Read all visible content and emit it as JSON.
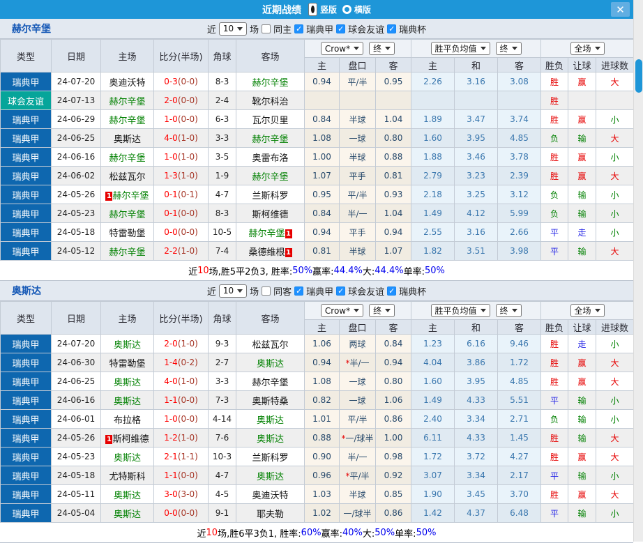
{
  "titlebar": {
    "title": "近期战绩",
    "view_vertical": "竖版",
    "view_horizontal": "横版",
    "close_label": "✕"
  },
  "table": {
    "columns": {
      "type": "类型",
      "date": "日期",
      "home": "主场",
      "score": "比分(半场)",
      "corner": "角球",
      "away": "客场",
      "odds_home": "主",
      "handicap": "盘口",
      "odds_away": "客",
      "mean_home": "主",
      "mean_draw": "和",
      "mean_away": "客",
      "result": "胜负",
      "handicap_result": "让球",
      "goals": "进球数"
    },
    "dropdowns": {
      "odds_source": "Crow*",
      "odds_stage": "终",
      "mean_source": "胜平负均值",
      "mean_stage": "终",
      "scope": "全场"
    }
  },
  "filter_labels": {
    "near": "近",
    "games": "场"
  },
  "sections": [
    {
      "team": "赫尔辛堡",
      "filter": {
        "count": "10",
        "same": "同主",
        "same_checked": false,
        "leagues": [
          "瑞典甲",
          "球会友谊",
          "瑞典杯"
        ]
      },
      "rows": [
        {
          "league": "瑞典甲",
          "league_type": "league",
          "date": "24-07-20",
          "home": {
            "name": "奥迪沃特",
            "green": false
          },
          "score": "0-3",
          "half": "(0-0)",
          "corners": "8-3",
          "away": {
            "name": "赫尔辛堡",
            "green": true
          },
          "odds": [
            "0.94",
            "平/半",
            "0.95"
          ],
          "means": [
            "2.26",
            "3.16",
            "3.08"
          ],
          "result": {
            "text": "胜",
            "color": "red"
          },
          "let_result": {
            "text": "赢",
            "color": "red"
          },
          "goals_result": {
            "text": "大",
            "color": "red"
          }
        },
        {
          "league": "球会友谊",
          "league_type": "friendly",
          "date": "24-07-13",
          "home": {
            "name": "赫尔辛堡",
            "green": true
          },
          "score": "2-0",
          "half": "(0-0)",
          "corners": "2-4",
          "away": {
            "name": "靴尔科治",
            "green": false
          },
          "odds": [
            "",
            "",
            ""
          ],
          "means": [
            "",
            "",
            ""
          ],
          "result": {
            "text": "胜",
            "color": "red"
          },
          "let_result": {
            "text": "",
            "color": "red"
          },
          "goals_result": {
            "text": "",
            "color": "red"
          }
        },
        {
          "league": "瑞典甲",
          "league_type": "league",
          "date": "24-06-29",
          "home": {
            "name": "赫尔辛堡",
            "green": true
          },
          "score": "1-0",
          "half": "(0-0)",
          "corners": "6-3",
          "away": {
            "name": "瓦尔贝里",
            "green": false
          },
          "odds": [
            "0.84",
            "半球",
            "1.04"
          ],
          "means": [
            "1.89",
            "3.47",
            "3.74"
          ],
          "result": {
            "text": "胜",
            "color": "red"
          },
          "let_result": {
            "text": "赢",
            "color": "red"
          },
          "goals_result": {
            "text": "小",
            "color": "green"
          }
        },
        {
          "league": "瑞典甲",
          "league_type": "league",
          "date": "24-06-25",
          "home": {
            "name": "奥斯达",
            "green": false
          },
          "score": "4-0",
          "half": "(1-0)",
          "corners": "3-3",
          "away": {
            "name": "赫尔辛堡",
            "green": true
          },
          "odds": [
            "1.08",
            "一球",
            "0.80"
          ],
          "means": [
            "1.60",
            "3.95",
            "4.85"
          ],
          "result": {
            "text": "负",
            "color": "green"
          },
          "let_result": {
            "text": "输",
            "color": "green"
          },
          "goals_result": {
            "text": "大",
            "color": "red"
          }
        },
        {
          "league": "瑞典甲",
          "league_type": "league",
          "date": "24-06-16",
          "home": {
            "name": "赫尔辛堡",
            "green": true
          },
          "score": "1-0",
          "half": "(1-0)",
          "corners": "3-5",
          "away": {
            "name": "奥雷布洛",
            "green": false
          },
          "odds": [
            "1.00",
            "半球",
            "0.88"
          ],
          "means": [
            "1.88",
            "3.46",
            "3.78"
          ],
          "result": {
            "text": "胜",
            "color": "red"
          },
          "let_result": {
            "text": "赢",
            "color": "red"
          },
          "goals_result": {
            "text": "小",
            "color": "green"
          }
        },
        {
          "league": "瑞典甲",
          "league_type": "league",
          "date": "24-06-02",
          "home": {
            "name": "松兹瓦尔",
            "green": false
          },
          "score": "1-3",
          "half": "(1-0)",
          "corners": "1-9",
          "away": {
            "name": "赫尔辛堡",
            "green": true
          },
          "odds": [
            "1.07",
            "平手",
            "0.81"
          ],
          "means": [
            "2.79",
            "3.23",
            "2.39"
          ],
          "result": {
            "text": "胜",
            "color": "red"
          },
          "let_result": {
            "text": "赢",
            "color": "red"
          },
          "goals_result": {
            "text": "大",
            "color": "red"
          }
        },
        {
          "league": "瑞典甲",
          "league_type": "league",
          "date": "24-05-26",
          "home": {
            "name": "赫尔辛堡",
            "green": true,
            "badge": "1",
            "badge_pos": "before"
          },
          "score": "0-1",
          "half": "(0-1)",
          "corners": "4-7",
          "away": {
            "name": "兰斯科罗",
            "green": false
          },
          "odds": [
            "0.95",
            "平/半",
            "0.93"
          ],
          "means": [
            "2.18",
            "3.25",
            "3.12"
          ],
          "result": {
            "text": "负",
            "color": "green"
          },
          "let_result": {
            "text": "输",
            "color": "green"
          },
          "goals_result": {
            "text": "小",
            "color": "green"
          }
        },
        {
          "league": "瑞典甲",
          "league_type": "league",
          "date": "24-05-23",
          "home": {
            "name": "赫尔辛堡",
            "green": true
          },
          "score": "0-1",
          "half": "(0-0)",
          "corners": "8-3",
          "away": {
            "name": "斯柯维德",
            "green": false
          },
          "odds": [
            "0.84",
            "半/一",
            "1.04"
          ],
          "means": [
            "1.49",
            "4.12",
            "5.99"
          ],
          "result": {
            "text": "负",
            "color": "green"
          },
          "let_result": {
            "text": "输",
            "color": "green"
          },
          "goals_result": {
            "text": "小",
            "color": "green"
          }
        },
        {
          "league": "瑞典甲",
          "league_type": "league",
          "date": "24-05-18",
          "home": {
            "name": "特雷勒堡",
            "green": false
          },
          "score": "0-0",
          "half": "(0-0)",
          "corners": "10-5",
          "away": {
            "name": "赫尔辛堡",
            "green": true,
            "badge": "1",
            "badge_pos": "after"
          },
          "odds": [
            "0.94",
            "平手",
            "0.94"
          ],
          "means": [
            "2.55",
            "3.16",
            "2.66"
          ],
          "result": {
            "text": "平",
            "color": "blue"
          },
          "let_result": {
            "text": "走",
            "color": "blue"
          },
          "goals_result": {
            "text": "小",
            "color": "green"
          }
        },
        {
          "league": "瑞典甲",
          "league_type": "league",
          "date": "24-05-12",
          "home": {
            "name": "赫尔辛堡",
            "green": true
          },
          "score": "2-2",
          "half": "(1-0)",
          "corners": "7-4",
          "away": {
            "name": "桑德维根",
            "green": false,
            "badge": "1",
            "badge_pos": "after"
          },
          "odds": [
            "0.81",
            "半球",
            "1.07"
          ],
          "means": [
            "1.82",
            "3.51",
            "3.98"
          ],
          "result": {
            "text": "平",
            "color": "blue"
          },
          "let_result": {
            "text": "输",
            "color": "green"
          },
          "goals_result": {
            "text": "大",
            "color": "red"
          }
        }
      ],
      "summary": [
        {
          "text": "近",
          "color": "black"
        },
        {
          "text": "10",
          "color": "red"
        },
        {
          "text": "场,胜5平2负3, 胜率:",
          "color": "black"
        },
        {
          "text": "50%",
          "color": "blue"
        },
        {
          "text": " 赢率:",
          "color": "black"
        },
        {
          "text": "44.4%",
          "color": "blue"
        },
        {
          "text": " 大:",
          "color": "black"
        },
        {
          "text": "44.4%",
          "color": "blue"
        },
        {
          "text": " 单率:",
          "color": "black"
        },
        {
          "text": "50%",
          "color": "blue"
        }
      ]
    },
    {
      "team": "奥斯达",
      "filter": {
        "count": "10",
        "same": "同客",
        "same_checked": false,
        "leagues": [
          "瑞典甲",
          "球会友谊",
          "瑞典杯"
        ]
      },
      "rows": [
        {
          "league": "瑞典甲",
          "league_type": "league",
          "date": "24-07-20",
          "home": {
            "name": "奥斯达",
            "green": true
          },
          "score": "2-0",
          "half": "(1-0)",
          "corners": "9-3",
          "away": {
            "name": "松兹瓦尔",
            "green": false
          },
          "odds": [
            "1.06",
            "两球",
            "0.84"
          ],
          "means": [
            "1.23",
            "6.16",
            "9.46"
          ],
          "result": {
            "text": "胜",
            "color": "red"
          },
          "let_result": {
            "text": "走",
            "color": "blue"
          },
          "goals_result": {
            "text": "小",
            "color": "green"
          }
        },
        {
          "league": "瑞典甲",
          "league_type": "league",
          "date": "24-06-30",
          "home": {
            "name": "特雷勒堡",
            "green": false
          },
          "score": "1-4",
          "half": "(0-2)",
          "corners": "2-7",
          "away": {
            "name": "奥斯达",
            "green": true
          },
          "odds": [
            "0.94",
            "*半/一",
            "0.94"
          ],
          "means": [
            "4.04",
            "3.86",
            "1.72"
          ],
          "result": {
            "text": "胜",
            "color": "red"
          },
          "let_result": {
            "text": "赢",
            "color": "red"
          },
          "goals_result": {
            "text": "大",
            "color": "red"
          }
        },
        {
          "league": "瑞典甲",
          "league_type": "league",
          "date": "24-06-25",
          "home": {
            "name": "奥斯达",
            "green": true
          },
          "score": "4-0",
          "half": "(1-0)",
          "corners": "3-3",
          "away": {
            "name": "赫尔辛堡",
            "green": false
          },
          "odds": [
            "1.08",
            "一球",
            "0.80"
          ],
          "means": [
            "1.60",
            "3.95",
            "4.85"
          ],
          "result": {
            "text": "胜",
            "color": "red"
          },
          "let_result": {
            "text": "赢",
            "color": "red"
          },
          "goals_result": {
            "text": "大",
            "color": "red"
          }
        },
        {
          "league": "瑞典甲",
          "league_type": "league",
          "date": "24-06-16",
          "home": {
            "name": "奥斯达",
            "green": true
          },
          "score": "1-1",
          "half": "(0-0)",
          "corners": "7-3",
          "away": {
            "name": "奥斯特桑",
            "green": false
          },
          "odds": [
            "0.82",
            "一球",
            "1.06"
          ],
          "means": [
            "1.49",
            "4.33",
            "5.51"
          ],
          "result": {
            "text": "平",
            "color": "blue"
          },
          "let_result": {
            "text": "输",
            "color": "green"
          },
          "goals_result": {
            "text": "小",
            "color": "green"
          }
        },
        {
          "league": "瑞典甲",
          "league_type": "league",
          "date": "24-06-01",
          "home": {
            "name": "布拉格",
            "green": false
          },
          "score": "1-0",
          "half": "(0-0)",
          "corners": "4-14",
          "away": {
            "name": "奥斯达",
            "green": true
          },
          "odds": [
            "1.01",
            "平/半",
            "0.86"
          ],
          "means": [
            "2.40",
            "3.34",
            "2.71"
          ],
          "result": {
            "text": "负",
            "color": "green"
          },
          "let_result": {
            "text": "输",
            "color": "green"
          },
          "goals_result": {
            "text": "小",
            "color": "green"
          }
        },
        {
          "league": "瑞典甲",
          "league_type": "league",
          "date": "24-05-26",
          "home": {
            "name": "斯柯维德",
            "green": false,
            "badge": "1",
            "badge_pos": "before"
          },
          "score": "1-2",
          "half": "(1-0)",
          "corners": "7-6",
          "away": {
            "name": "奥斯达",
            "green": true
          },
          "odds": [
            "0.88",
            "*一/球半",
            "1.00"
          ],
          "means": [
            "6.11",
            "4.33",
            "1.45"
          ],
          "result": {
            "text": "胜",
            "color": "red"
          },
          "let_result": {
            "text": "输",
            "color": "green"
          },
          "goals_result": {
            "text": "大",
            "color": "red"
          }
        },
        {
          "league": "瑞典甲",
          "league_type": "league",
          "date": "24-05-23",
          "home": {
            "name": "奥斯达",
            "green": true
          },
          "score": "2-1",
          "half": "(1-1)",
          "corners": "10-3",
          "away": {
            "name": "兰斯科罗",
            "green": false
          },
          "odds": [
            "0.90",
            "半/一",
            "0.98"
          ],
          "means": [
            "1.72",
            "3.72",
            "4.27"
          ],
          "result": {
            "text": "胜",
            "color": "red"
          },
          "let_result": {
            "text": "赢",
            "color": "red"
          },
          "goals_result": {
            "text": "大",
            "color": "red"
          }
        },
        {
          "league": "瑞典甲",
          "league_type": "league",
          "date": "24-05-18",
          "home": {
            "name": "尤特斯科",
            "green": false
          },
          "score": "1-1",
          "half": "(0-0)",
          "corners": "4-7",
          "away": {
            "name": "奥斯达",
            "green": true
          },
          "odds": [
            "0.96",
            "*平/半",
            "0.92"
          ],
          "means": [
            "3.07",
            "3.34",
            "2.17"
          ],
          "result": {
            "text": "平",
            "color": "blue"
          },
          "let_result": {
            "text": "输",
            "color": "green"
          },
          "goals_result": {
            "text": "小",
            "color": "green"
          }
        },
        {
          "league": "瑞典甲",
          "league_type": "league",
          "date": "24-05-11",
          "home": {
            "name": "奥斯达",
            "green": true
          },
          "score": "3-0",
          "half": "(3-0)",
          "corners": "4-5",
          "away": {
            "name": "奥迪沃特",
            "green": false
          },
          "odds": [
            "1.03",
            "半球",
            "0.85"
          ],
          "means": [
            "1.90",
            "3.45",
            "3.70"
          ],
          "result": {
            "text": "胜",
            "color": "red"
          },
          "let_result": {
            "text": "赢",
            "color": "red"
          },
          "goals_result": {
            "text": "大",
            "color": "red"
          }
        },
        {
          "league": "瑞典甲",
          "league_type": "league",
          "date": "24-05-04",
          "home": {
            "name": "奥斯达",
            "green": true
          },
          "score": "0-0",
          "half": "(0-0)",
          "corners": "9-1",
          "away": {
            "name": "耶夫勒",
            "green": false
          },
          "odds": [
            "1.02",
            "一/球半",
            "0.86"
          ],
          "means": [
            "1.42",
            "4.37",
            "6.48"
          ],
          "result": {
            "text": "平",
            "color": "blue"
          },
          "let_result": {
            "text": "输",
            "color": "green"
          },
          "goals_result": {
            "text": "小",
            "color": "green"
          }
        }
      ],
      "summary": [
        {
          "text": "近",
          "color": "black"
        },
        {
          "text": "10",
          "color": "red"
        },
        {
          "text": "场,胜6平3负1, 胜率:",
          "color": "black"
        },
        {
          "text": "60%",
          "color": "blue"
        },
        {
          "text": " 赢率:",
          "color": "black"
        },
        {
          "text": "40%",
          "color": "blue"
        },
        {
          "text": " 大:",
          "color": "black"
        },
        {
          "text": "50%",
          "color": "blue"
        },
        {
          "text": " 单率:",
          "color": "black"
        },
        {
          "text": "50%",
          "color": "blue"
        }
      ]
    }
  ],
  "colors": {
    "titlebar": "#1E96D8",
    "league_cell": "#0E67AF",
    "friendly_cell": "#06A59A",
    "win_red": "#E60000",
    "lose_green": "#008000",
    "draw_blue": "#2222E6",
    "team_green": "#008000",
    "score_red": "#FF0000"
  }
}
